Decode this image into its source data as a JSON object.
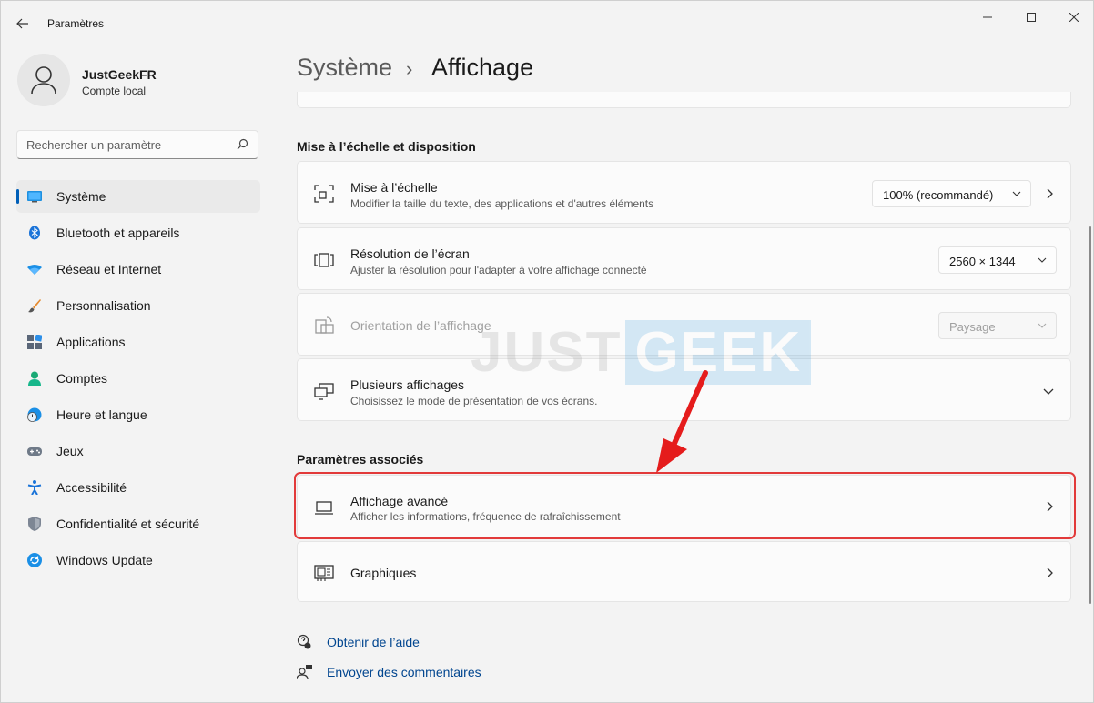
{
  "window": {
    "title": "Paramètres"
  },
  "profile": {
    "name": "JustGeekFR",
    "account_type": "Compte local"
  },
  "search": {
    "placeholder": "Rechercher un paramètre"
  },
  "sidebar": {
    "items": [
      {
        "label": "Système",
        "icon": "monitor-icon",
        "active": true
      },
      {
        "label": "Bluetooth et appareils",
        "icon": "bluetooth-icon"
      },
      {
        "label": "Réseau et Internet",
        "icon": "wifi-icon"
      },
      {
        "label": "Personnalisation",
        "icon": "brush-icon"
      },
      {
        "label": "Applications",
        "icon": "apps-icon"
      },
      {
        "label": "Comptes",
        "icon": "account-icon"
      },
      {
        "label": "Heure et langue",
        "icon": "clock-globe-icon"
      },
      {
        "label": "Jeux",
        "icon": "gamepad-icon"
      },
      {
        "label": "Accessibilité",
        "icon": "accessibility-icon"
      },
      {
        "label": "Confidentialité et sécurité",
        "icon": "shield-icon"
      },
      {
        "label": "Windows Update",
        "icon": "update-icon"
      }
    ]
  },
  "breadcrumb": {
    "parent": "Système",
    "separator": "›",
    "current": "Affichage"
  },
  "sections": {
    "scale_layout": "Mise à l’échelle et disposition",
    "related": "Paramètres associés"
  },
  "cards": {
    "scale": {
      "title": "Mise à l’échelle",
      "description": "Modifier la taille du texte, des applications et d'autres éléments",
      "value": "100% (recommandé)"
    },
    "resolution": {
      "title": "Résolution de l’écran",
      "description": "Ajuster  la résolution pour l'adapter à votre  affichage connecté",
      "value": "2560 × 1344"
    },
    "orientation": {
      "title": "Orientation de l’affichage",
      "value": "Paysage",
      "disabled": true
    },
    "multiple": {
      "title": "Plusieurs affichages",
      "description": "Choisissez le mode de présentation de vos écrans."
    },
    "advanced": {
      "title": "Affichage avancé",
      "description": "Afficher les informations, fréquence de rafraîchissement",
      "highlighted": true
    },
    "graphics": {
      "title": "Graphiques"
    }
  },
  "links": {
    "help": "Obtenir de l’aide",
    "feedback": "Envoyer des commentaires"
  },
  "watermark": {
    "part1": "JUST",
    "part2": "GEEK"
  },
  "colors": {
    "accent": "#005fb8",
    "highlight": "#e23a3a",
    "link": "#00458f",
    "background": "#f3f3f3"
  }
}
